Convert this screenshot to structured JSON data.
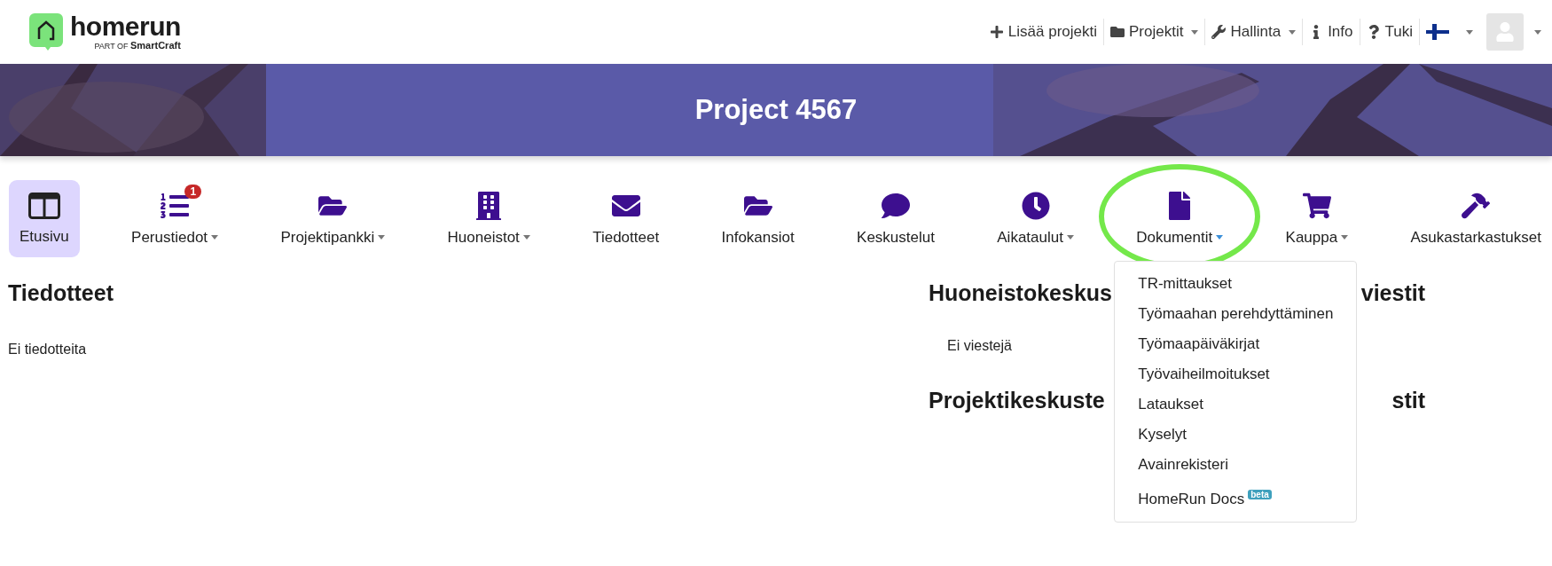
{
  "logo": {
    "name": "homerun",
    "tagline": "PART OF **SmartCraft**"
  },
  "top_menu": [
    {
      "label": "Lisää projekti",
      "dropdown": false
    },
    {
      "label": "Projektit",
      "dropdown": true
    },
    {
      "label": "Hallinta",
      "dropdown": true
    },
    {
      "label": "Info",
      "dropdown": false
    },
    {
      "label": "Tuki",
      "dropdown": false
    }
  ],
  "language": {
    "dropdown": true
  },
  "banner": {
    "title": "Project 4567"
  },
  "nav": [
    {
      "label": "Etusivu",
      "selected": true,
      "dropdown": false
    },
    {
      "label": "Perustiedot",
      "selected": false,
      "dropdown": true,
      "expanded": false,
      "badge": "1"
    },
    {
      "label": "Projektipankki",
      "selected": false,
      "dropdown": true,
      "expanded": false
    },
    {
      "label": "Huoneistot",
      "selected": false,
      "dropdown": true,
      "expanded": false
    },
    {
      "label": "Tiedotteet",
      "selected": false,
      "dropdown": false
    },
    {
      "label": "Infokansiot",
      "selected": false,
      "dropdown": false
    },
    {
      "label": "Keskustelut",
      "selected": false,
      "dropdown": false
    },
    {
      "label": "Aikataulut",
      "selected": false,
      "dropdown": true,
      "expanded": false
    },
    {
      "label": "Dokumentit",
      "selected": false,
      "dropdown": true,
      "expanded": true,
      "highlighted": true
    },
    {
      "label": "Kauppa",
      "selected": false,
      "dropdown": true,
      "expanded": false
    },
    {
      "label": "Asukastarkastukset",
      "selected": false,
      "dropdown": false
    }
  ],
  "dropdown_menu": [
    {
      "label": "TR-mittaukset"
    },
    {
      "label": "Työmaahan perehdyttäminen"
    },
    {
      "label": "Työmaapäiväkirjat"
    },
    {
      "label": "Työvaiheilmoitukset"
    },
    {
      "label": "Lataukset"
    },
    {
      "label": "Kyselyt"
    },
    {
      "label": "Avainrekisteri"
    },
    {
      "label": "HomeRun Docs",
      "badge": "beta"
    }
  ],
  "left_section": {
    "heading": "Tiedotteet",
    "empty_text": "Ei tiedotteita"
  },
  "right_sections": [
    {
      "heading_start": "Huoneistokeskus",
      "heading_end": "viestit",
      "empty_text": "Ei viestejä"
    },
    {
      "heading_start": "Projektikeskuste",
      "heading_end": "stit"
    }
  ]
}
